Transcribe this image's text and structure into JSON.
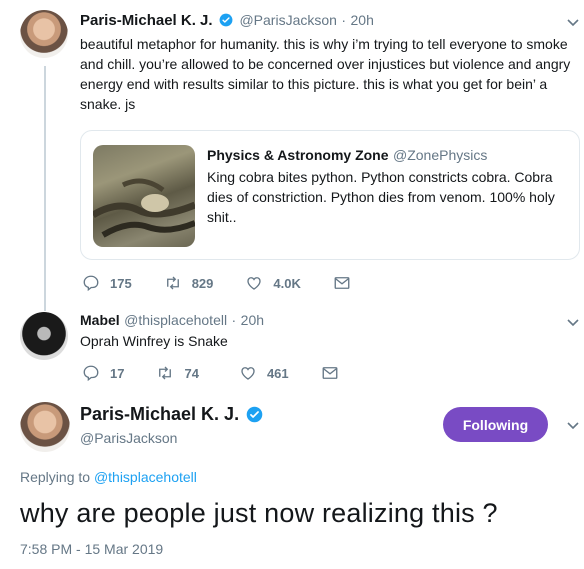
{
  "tweet1": {
    "name": "Paris-Michael K. J.",
    "handle": "@ParisJackson",
    "time": "20h",
    "separator": "·",
    "text": "beautiful metaphor for humanity. this is why i’m trying to tell everyone to smoke and chill. you’re allowed to be concerned over injustices but violence and angry energy end with results similar to this picture. this is what you get for bein’ a snake. js",
    "quoted": {
      "name": "Physics & Astronomy Zone",
      "handle": "@ZonePhysics",
      "text": "King cobra bites python. Python constricts cobra. Cobra dies of constriction. Python dies from venom. 100% holy shit.."
    },
    "stats": {
      "replies": "175",
      "retweets": "829",
      "likes": "4.0K"
    }
  },
  "tweet2": {
    "name": "Mabel",
    "handle": "@thisplacehotell",
    "time": "20h",
    "separator": "·",
    "text": "Oprah Winfrey is Snake",
    "stats": {
      "replies": "17",
      "retweets": "74",
      "likes": "461"
    }
  },
  "main": {
    "name": "Paris-Michael K. J.",
    "handle": "@ParisJackson",
    "follow_label": "Following",
    "replying_prefix": "Replying to",
    "replying_to": "@thisplacehotell",
    "text": "why are people just now realizing this ?",
    "timestamp": "7:58 PM - 15 Mar 2019"
  },
  "icons": {
    "verified": "verified-badge-icon",
    "reply": "reply-icon",
    "retweet": "retweet-icon",
    "like": "heart-icon",
    "dm": "envelope-icon",
    "more": "chevron-down-icon"
  },
  "colors": {
    "verified_blue": "#1da1f2",
    "following_purple": "#794bc4",
    "muted": "#657786"
  }
}
